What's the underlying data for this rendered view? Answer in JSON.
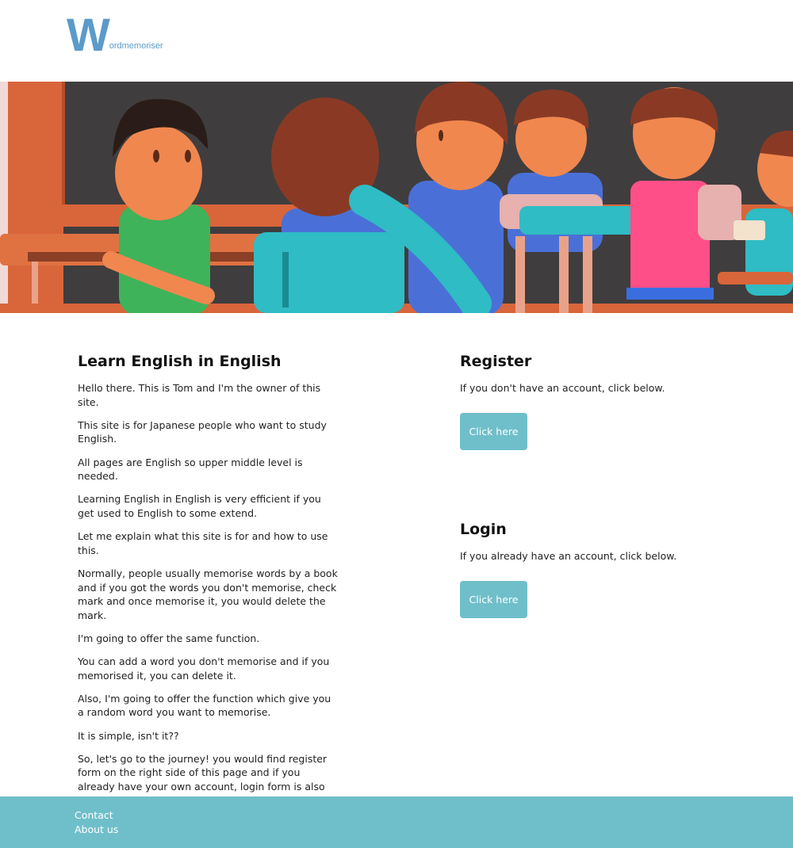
{
  "header": {
    "logo_initial": "W",
    "logo_rest": "ordmemoriser"
  },
  "hero": {
    "image_description_icon": "classroom-illustration"
  },
  "intro": {
    "heading": "Learn English in English",
    "paragraphs": [
      "Hello there. This is Tom and I'm the owner of this site.",
      "This site is for Japanese people who want to study English.",
      "All pages are English so upper middle level is needed.",
      "Learning English in English is very efficient if you get used to English to some extend.",
      "Let me explain what this site is for and how to use this.",
      "Normally, people usually memorise words by a book and if you got the words you don't memorise, check mark and once memorise it, you would delete the mark.",
      "I'm going to offer the same function.",
      "You can add a word you don't memorise and if you memorised it, you can delete it.",
      "Also, I'm going to offer the function which give you a random word you want to memorise.",
      "It is simple, isn't it??",
      "So, let's go to the journey! you would find register form on the right side of this page and if you already have your own account, login form is also there."
    ]
  },
  "register": {
    "heading": "Register",
    "text": "If you don't have an account, click below.",
    "button_label": "Click here"
  },
  "login": {
    "heading": "Login",
    "text": "If you already have an account, click below.",
    "button_label": "Click here"
  },
  "footer": {
    "links": [
      "Contact",
      "About us"
    ]
  },
  "colors": {
    "accent": "#6fbfca",
    "logo": "#5b9bc9"
  }
}
